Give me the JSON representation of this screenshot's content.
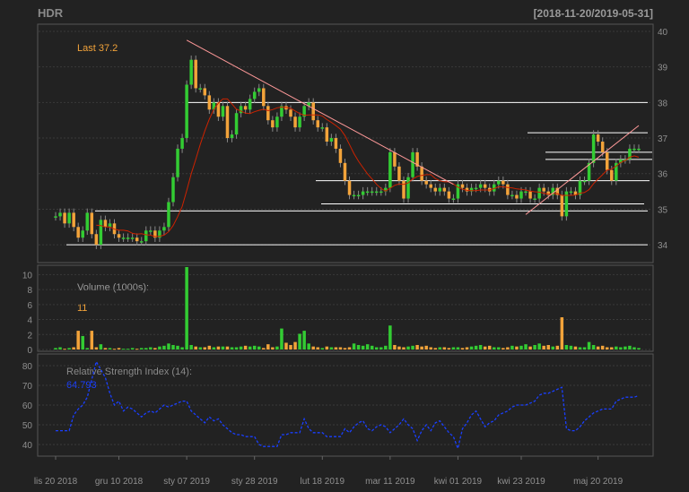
{
  "header": {
    "symbol": "HDR",
    "date_range": "[2018-11-20/2019-05-31]"
  },
  "price_panel": {
    "last_label": "Last 37.2",
    "y_ticks": [
      "34",
      "35",
      "36",
      "37",
      "38",
      "39",
      "40"
    ]
  },
  "volume_panel": {
    "title": "Volume (1000s):",
    "value": "11",
    "y_ticks": [
      "0",
      "2",
      "4",
      "6",
      "8",
      "10"
    ]
  },
  "rsi_panel": {
    "title": "Relative Strength Index (14):",
    "value": "64.793",
    "y_ticks": [
      "40",
      "50",
      "60",
      "70",
      "80"
    ]
  },
  "x_ticks": [
    "lis 20 2018",
    "gru 10 2018",
    "sty 07 2019",
    "sty 28 2019",
    "lut 18 2019",
    "mar 11 2019",
    "kwi 01 2019",
    "kwi 23 2019",
    "maj 20 2019"
  ],
  "colors": {
    "background": "#222222",
    "up": "#33cc33",
    "down": "#f2a33a",
    "ma": "#cc2200",
    "rsi": "#1a3fff",
    "trend": "#ff9999",
    "level": "#ffffff",
    "last_text": "#f2a33a",
    "rsi_value_text": "#1a3fff"
  },
  "chart_data": {
    "type": "candlestick",
    "x_dates": [
      "2018-11-20",
      "2018-11-21",
      "2018-11-22",
      "2018-11-23",
      "2018-11-26",
      "2018-11-27",
      "2018-11-28",
      "2018-11-29",
      "2018-11-30",
      "2018-12-03",
      "2018-12-04",
      "2018-12-05",
      "2018-12-06",
      "2018-12-07",
      "2018-12-10",
      "2018-12-11",
      "2018-12-12",
      "2018-12-13",
      "2018-12-14",
      "2018-12-17",
      "2018-12-18",
      "2018-12-19",
      "2018-12-20",
      "2018-12-21",
      "2018-12-27",
      "2018-12-28",
      "2019-01-02",
      "2019-01-03",
      "2019-01-04",
      "2019-01-07",
      "2019-01-08",
      "2019-01-09",
      "2019-01-10",
      "2019-01-11",
      "2019-01-14",
      "2019-01-15",
      "2019-01-16",
      "2019-01-17",
      "2019-01-18",
      "2019-01-21",
      "2019-01-22",
      "2019-01-23",
      "2019-01-24",
      "2019-01-25",
      "2019-01-28",
      "2019-01-29",
      "2019-01-30",
      "2019-01-31",
      "2019-02-01",
      "2019-02-04",
      "2019-02-05",
      "2019-02-06",
      "2019-02-07",
      "2019-02-08",
      "2019-02-11",
      "2019-02-12",
      "2019-02-13",
      "2019-02-14",
      "2019-02-15",
      "2019-02-18",
      "2019-02-19",
      "2019-02-20",
      "2019-02-21",
      "2019-02-22",
      "2019-02-25",
      "2019-02-26",
      "2019-02-27",
      "2019-02-28",
      "2019-03-01",
      "2019-03-04",
      "2019-03-05",
      "2019-03-06",
      "2019-03-07",
      "2019-03-08",
      "2019-03-11",
      "2019-03-12",
      "2019-03-13",
      "2019-03-14",
      "2019-03-15",
      "2019-03-18",
      "2019-03-19",
      "2019-03-20",
      "2019-03-21",
      "2019-03-22",
      "2019-03-25",
      "2019-03-26",
      "2019-03-27",
      "2019-03-28",
      "2019-03-29",
      "2019-04-01",
      "2019-04-02",
      "2019-04-03",
      "2019-04-04",
      "2019-04-05",
      "2019-04-08",
      "2019-04-09",
      "2019-04-10",
      "2019-04-11",
      "2019-04-12",
      "2019-04-15",
      "2019-04-16",
      "2019-04-17",
      "2019-04-18",
      "2019-04-23",
      "2019-04-24",
      "2019-04-25",
      "2019-04-26",
      "2019-04-29",
      "2019-04-30",
      "2019-05-02",
      "2019-05-06",
      "2019-05-07",
      "2019-05-08",
      "2019-05-09",
      "2019-05-10",
      "2019-05-13",
      "2019-05-14",
      "2019-05-15",
      "2019-05-16",
      "2019-05-17",
      "2019-05-20",
      "2019-05-21",
      "2019-05-22",
      "2019-05-23",
      "2019-05-24",
      "2019-05-27",
      "2019-05-28",
      "2019-05-29",
      "2019-05-30",
      "2019-05-31"
    ],
    "close": [
      34.8,
      34.9,
      34.6,
      34.9,
      34.5,
      34.2,
      34.4,
      34.9,
      34.3,
      34.0,
      34.7,
      34.5,
      34.6,
      34.3,
      34.2,
      34.2,
      34.2,
      34.2,
      34.1,
      34.1,
      34.4,
      34.4,
      34.2,
      34.4,
      34.5,
      35.2,
      35.9,
      36.7,
      37.0,
      38.5,
      39.2,
      38.4,
      38.4,
      38.2,
      37.8,
      38.0,
      37.6,
      37.9,
      37.0,
      37.1,
      37.7,
      37.9,
      37.8,
      38.1,
      38.3,
      38.4,
      37.9,
      37.5,
      37.3,
      37.6,
      37.9,
      37.8,
      37.6,
      37.3,
      37.6,
      37.9,
      38.0,
      37.5,
      37.3,
      37.3,
      36.9,
      37.0,
      36.7,
      36.3,
      35.8,
      35.4,
      35.4,
      35.4,
      35.5,
      35.5,
      35.5,
      35.5,
      35.5,
      35.6,
      36.6,
      36.2,
      35.8,
      35.3,
      35.9,
      36.6,
      36.2,
      35.8,
      35.7,
      35.6,
      35.5,
      35.6,
      35.5,
      35.3,
      35.3,
      35.7,
      35.6,
      35.5,
      35.6,
      35.6,
      35.7,
      35.6,
      35.5,
      35.7,
      35.8,
      35.7,
      35.4,
      35.4,
      35.3,
      35.5,
      35.5,
      35.3,
      35.3,
      35.6,
      35.5,
      35.4,
      35.6,
      35.4,
      34.8,
      35.5,
      35.5,
      35.4,
      35.8,
      35.8,
      36.3,
      37.1,
      36.9,
      36.6,
      36.1,
      35.8,
      36.3,
      36.4,
      36.4,
      36.7,
      36.7,
      36.7
    ],
    "volume_1000s": [
      0.2,
      0.3,
      0.1,
      0.2,
      0.3,
      2.5,
      1.8,
      0.2,
      2.5,
      0.3,
      0.7,
      0.2,
      0.2,
      0.1,
      0.2,
      0.1,
      0.1,
      0.2,
      0.1,
      0.2,
      0.2,
      0.3,
      0.2,
      0.4,
      0.5,
      0.8,
      0.6,
      0.5,
      0.3,
      11.0,
      0.6,
      0.4,
      0.3,
      0.3,
      0.5,
      0.3,
      0.4,
      0.4,
      0.4,
      0.3,
      0.3,
      0.4,
      0.5,
      0.4,
      0.5,
      0.4,
      0.2,
      0.7,
      0.3,
      0.4,
      2.8,
      0.9,
      0.6,
      1.0,
      2.1,
      2.5,
      0.8,
      0.4,
      0.3,
      0.2,
      0.4,
      0.3,
      0.3,
      0.3,
      0.2,
      0.3,
      0.8,
      0.6,
      0.5,
      0.7,
      0.5,
      0.3,
      0.3,
      0.5,
      3.2,
      0.6,
      0.4,
      0.3,
      0.4,
      0.5,
      0.6,
      0.4,
      0.5,
      0.3,
      0.2,
      0.3,
      0.3,
      0.2,
      0.3,
      0.3,
      0.2,
      0.3,
      0.4,
      0.5,
      0.6,
      0.4,
      0.5,
      0.3,
      0.3,
      0.2,
      0.3,
      0.5,
      0.4,
      0.5,
      0.7,
      0.4,
      0.6,
      0.8,
      0.5,
      0.6,
      0.4,
      0.5,
      4.3,
      0.6,
      0.5,
      0.4,
      0.3,
      0.3,
      1.0,
      0.6,
      0.4,
      0.5,
      0.3,
      0.3,
      0.4,
      0.3,
      0.4,
      0.5,
      0.3,
      0.2
    ],
    "rsi_14": [
      50,
      45,
      41,
      46,
      45,
      43,
      46,
      47,
      47,
      47,
      47,
      47,
      55,
      58,
      60,
      64,
      73,
      82,
      78,
      74,
      66,
      60,
      62,
      57,
      59,
      58,
      56,
      54,
      56,
      57,
      56,
      58,
      60,
      59,
      60,
      61,
      62,
      62,
      57,
      55,
      53,
      51,
      54,
      52,
      53,
      50,
      48,
      46,
      45,
      45,
      44,
      44,
      44,
      40,
      39,
      39,
      39,
      39,
      45,
      45,
      46,
      46,
      46,
      53,
      48,
      46,
      46,
      46,
      44,
      44,
      44,
      44,
      48,
      46,
      49,
      51,
      52,
      48,
      47,
      49,
      50,
      49,
      46,
      48,
      50,
      53,
      50,
      48,
      42,
      47,
      50,
      47,
      51,
      52,
      49,
      46,
      44,
      38,
      48,
      51,
      55,
      57,
      53,
      49,
      51,
      52,
      55,
      56,
      57,
      59,
      60,
      60,
      60,
      61,
      62,
      65,
      66,
      66,
      67,
      68,
      69,
      48,
      47,
      47,
      49,
      52,
      54,
      56,
      57,
      58,
      58,
      58,
      62,
      63,
      64,
      64,
      64,
      64.8
    ],
    "support_resistance_levels": [
      34.0,
      34.95,
      35.15,
      35.8,
      36.4,
      36.6,
      37.15,
      38.0
    ],
    "trendlines": [
      {
        "from": {
          "date": "2019-01-07",
          "value": 39.75
        },
        "to": {
          "date": "2019-03-29",
          "value": 35.7
        }
      },
      {
        "from": {
          "date": "2019-04-24",
          "value": 34.85
        },
        "to": {
          "date": "2019-05-31",
          "value": 37.35
        }
      }
    ],
    "y_range_price": [
      33.5,
      40.2
    ],
    "y_range_volume": [
      0,
      11
    ],
    "y_range_rsi": [
      35,
      85
    ],
    "moving_average": "red line over price",
    "grid": true
  }
}
